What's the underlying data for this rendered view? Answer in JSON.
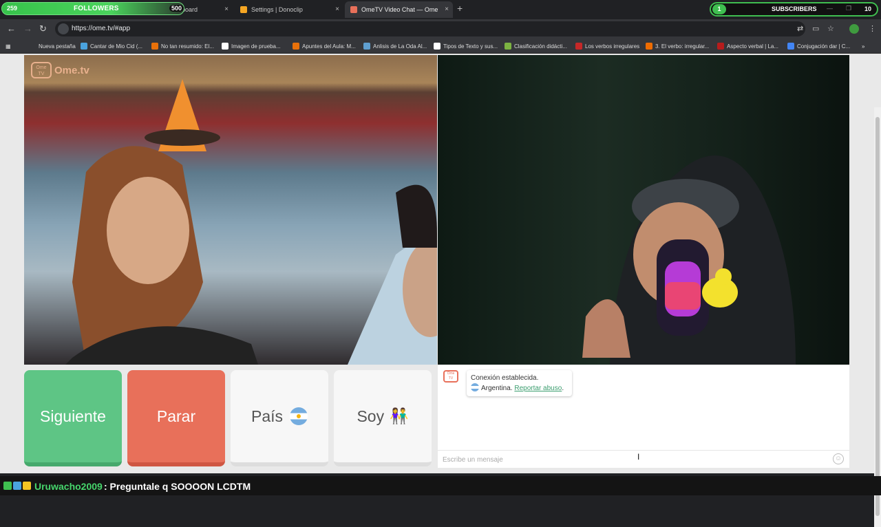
{
  "overlay": {
    "followers": {
      "count": "259",
      "label": "FOLLOWERS",
      "goal": "500"
    },
    "subscribers": {
      "count": "1",
      "label": "SUBSCRIBERS",
      "goal": "10"
    }
  },
  "tabs": [
    {
      "title": "Stream - Ki...shboard",
      "close": "×"
    },
    {
      "title": "Settings | Donoclip",
      "close": "×"
    },
    {
      "title": "OmeTV Video Chat — Ome",
      "close": "×"
    }
  ],
  "new_tab": "+",
  "window_controls": {
    "minimize": "—",
    "restore": "❐"
  },
  "address_bar": {
    "url": "https://ome.tv/#app"
  },
  "bookmarks": [
    {
      "label": "Nueva pestaña",
      "color": "#5f6368"
    },
    {
      "label": "Cantar de Mio Cid (...",
      "color": "#4aa3df"
    },
    {
      "label": "No tan resumido: El...",
      "color": "#e8710a"
    },
    {
      "label": "Imagen de prueba...",
      "color": "#ffffff"
    },
    {
      "label": "Apuntes del Aula: M...",
      "color": "#e8710a"
    },
    {
      "label": "Anlisis de La Oda Al...",
      "color": "#5f9fd0"
    },
    {
      "label": "Tipos de Texto y sus...",
      "color": "#ffffff"
    },
    {
      "label": "Clasificación didácti...",
      "color": "#7cb342"
    },
    {
      "label": "Los verbos irregulares",
      "color": "#c62828"
    },
    {
      "label": "3. El verbo: irregular...",
      "color": "#ef6c00"
    },
    {
      "label": "Aspecto verbal | La...",
      "color": "#b71c1c"
    },
    {
      "label": "Conjugación dar | C...",
      "color": "#4285f4"
    }
  ],
  "app": {
    "logo": "Ome.tv",
    "buttons": {
      "next": "Siguiente",
      "stop": "Parar",
      "country": "País",
      "gender": "Soy"
    },
    "chat": {
      "status": "Conexión establecida.",
      "country": "Argentina.",
      "report": "Reportar abuso",
      "placeholder": "Escribe un mensaje"
    }
  },
  "ticker": {
    "user": "Uruwacho2009",
    "message": ": Preguntale q SOOOON LCDTM"
  },
  "colors": {
    "next": "#5ec585",
    "stop": "#e8705a",
    "accent": "#3a9d6e"
  }
}
